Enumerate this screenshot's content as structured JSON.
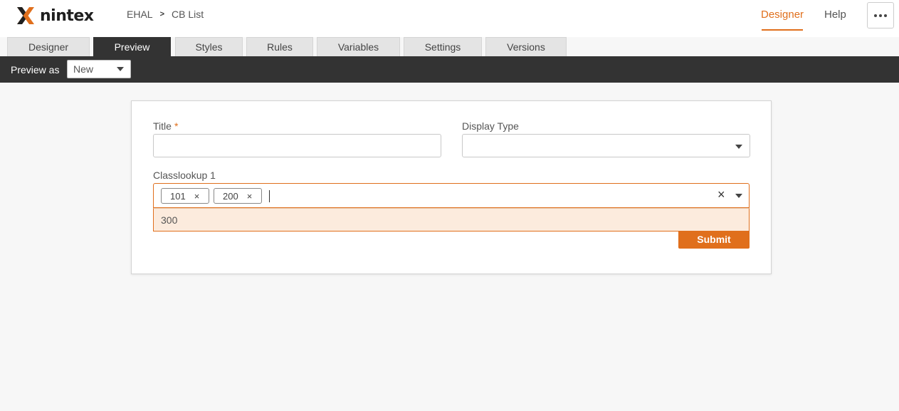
{
  "header": {
    "logo_text": "nintex",
    "breadcrumb": [
      "EHAL",
      "CB List"
    ],
    "nav": [
      {
        "label": "Designer",
        "active": true
      },
      {
        "label": "Help",
        "active": false
      }
    ],
    "more_icon": "ellipsis-icon"
  },
  "tabs": [
    {
      "label": "Designer",
      "active": false
    },
    {
      "label": "Preview",
      "active": true
    },
    {
      "label": "Styles",
      "active": false
    },
    {
      "label": "Rules",
      "active": false
    },
    {
      "label": "Variables",
      "active": false
    },
    {
      "label": "Settings",
      "active": false
    },
    {
      "label": "Versions",
      "active": false
    }
  ],
  "preview_bar": {
    "label": "Preview as",
    "selected": "New"
  },
  "form": {
    "title_label": "Title",
    "required_mark": "*",
    "title_value": "",
    "display_type_label": "Display Type",
    "display_type_value": "",
    "classlookup_label": "Classlookup 1",
    "classlookup_chips": [
      "101",
      "200"
    ],
    "chip_remove_glyph": "×",
    "clear_glyph": "×",
    "dropdown_options": [
      "300"
    ],
    "submit_label": "Submit"
  },
  "colors": {
    "accent": "#e06f1c",
    "dark_bar": "#333333",
    "dropdown_highlight": "#fcebdd"
  }
}
